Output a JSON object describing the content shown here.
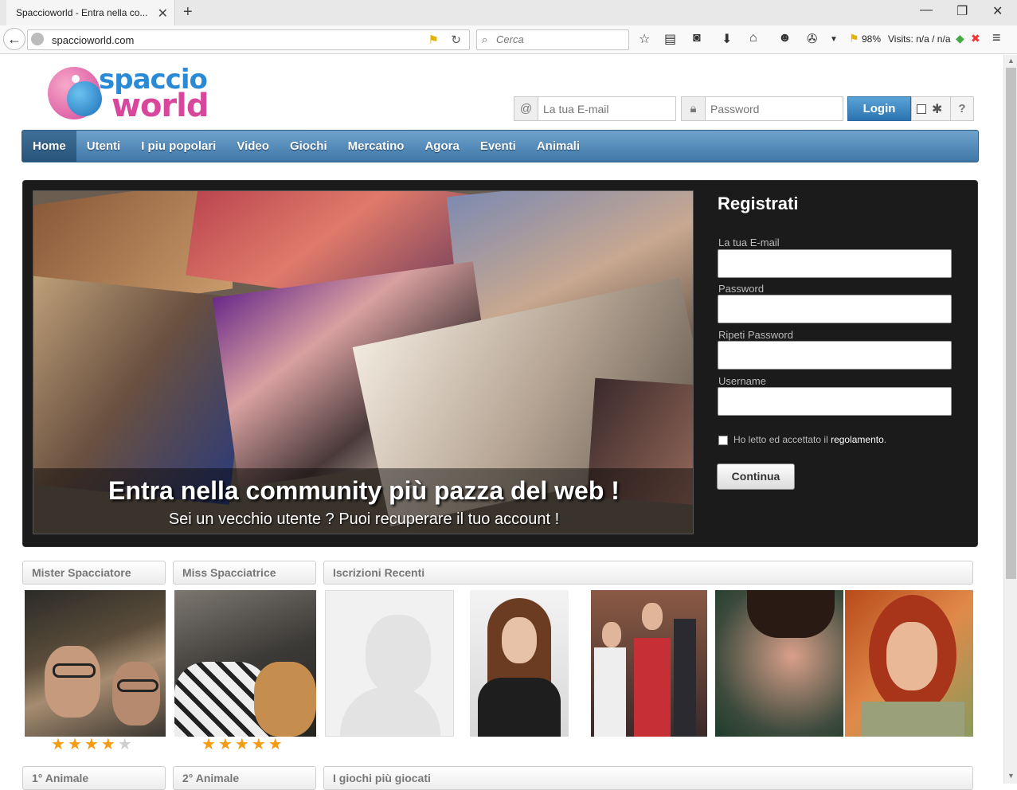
{
  "browser": {
    "tab_title": "Spaccioworld - Entra nella co...",
    "url": "spaccioworld.com",
    "search_placeholder": "Cerca",
    "zoom": "98%",
    "visits": "Visits: n/a / n/a"
  },
  "site": {
    "logo_line1": "spaccio",
    "logo_line2": "world",
    "login": {
      "email_placeholder": "La tua E-mail",
      "password_placeholder": "Password",
      "button": "Login",
      "help": "?"
    },
    "menu": [
      "Home",
      "Utenti",
      "I piu popolari",
      "Video",
      "Giochi",
      "Mercatino",
      "Agora",
      "Eventi",
      "Animali"
    ],
    "hero": {
      "title": "Entra nella community più pazza del web !",
      "subtitle": "Sei un vecchio utente ? Puoi recuperare il tuo account !"
    },
    "register": {
      "title": "Registrati",
      "email_label": "La tua E-mail",
      "password_label": "Password",
      "repeat_label": "Ripeti Password",
      "username_label": "Username",
      "agree_text": "Ho letto ed accettato il",
      "agree_link": "regolamento",
      "agree_end": ".",
      "submit": "Continua"
    },
    "sections": {
      "mister": "Mister Spacciatore",
      "miss": "Miss Spacciatrice",
      "recent": "Iscrizioni Recenti",
      "animal1": "1° Animale",
      "animal2": "2° Animale",
      "games": "I giochi più giocati"
    },
    "mister_rating": 4,
    "miss_rating": 5,
    "rating_max": 5
  },
  "colors": {
    "menu": "#3f77a8",
    "hero_bg": "#1b1b1b",
    "accent_pink": "#d8479c",
    "accent_blue": "#2a8ad6",
    "star": "#f39c12"
  }
}
